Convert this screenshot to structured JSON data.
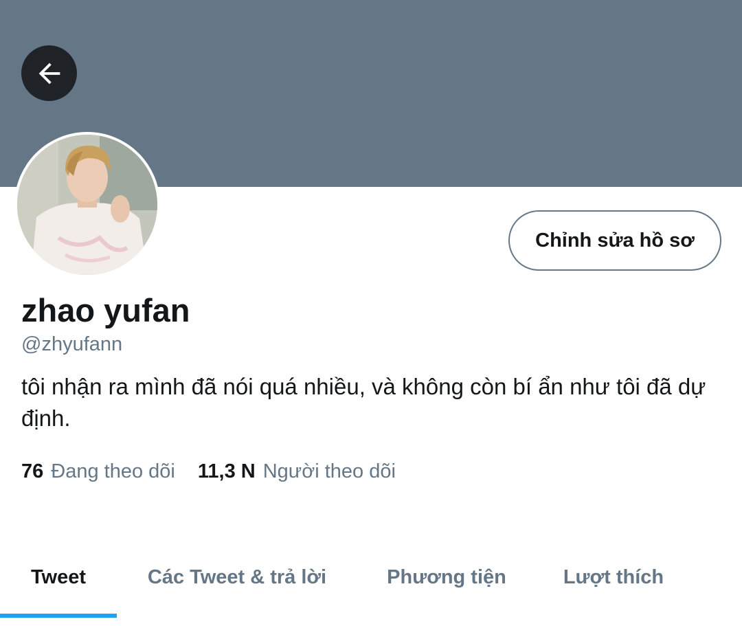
{
  "header": {
    "back_icon": "arrow-left-icon",
    "banner_color": "#657786"
  },
  "profile": {
    "display_name": "zhao yufan",
    "handle": "@zhyufann",
    "bio": "tôi nhận ra mình đã nói quá nhiều, và không còn bí ẩn như tôi đã dự định.",
    "edit_button_label": "Chỉnh sửa hồ sơ"
  },
  "stats": {
    "following_count": "76",
    "following_label": "Đang theo dõi",
    "followers_count": "11,3 N",
    "followers_label": "Người theo dõi"
  },
  "tabs": [
    {
      "label": "Tweet",
      "active": true
    },
    {
      "label": "Các Tweet & trả lời",
      "active": false
    },
    {
      "label": "Phương tiện",
      "active": false
    },
    {
      "label": "Lượt thích",
      "active": false
    }
  ],
  "colors": {
    "accent": "#1da1f2",
    "text_primary": "#14171a",
    "text_secondary": "#657786"
  }
}
